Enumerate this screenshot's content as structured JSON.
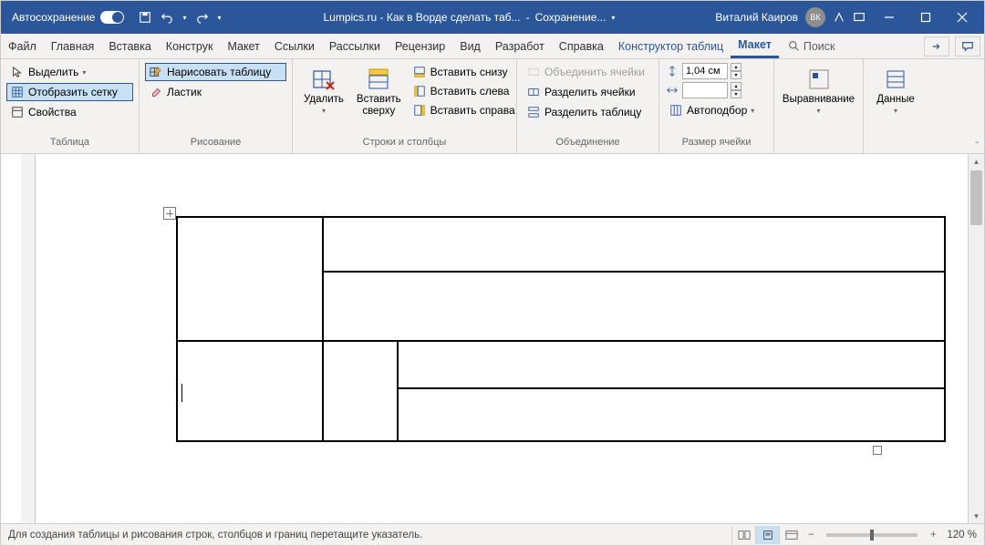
{
  "titlebar": {
    "autosave": "Автосохранение",
    "doc_title": "Lumpics.ru - Как в Ворде сделать таб...",
    "saving": "Сохранение...",
    "user_name": "Виталий Каиров",
    "user_initials": "ВК"
  },
  "tabs": {
    "file": "Файл",
    "home": "Главная",
    "insert": "Вставка",
    "design": "Конструк",
    "layout": "Макет",
    "references": "Ссылки",
    "mailings": "Рассылки",
    "review": "Рецензир",
    "view": "Вид",
    "developer": "Разработ",
    "help": "Справка",
    "table_design": "Конструктор таблиц",
    "table_layout": "Макет",
    "search": "Поиск"
  },
  "ribbon": {
    "table": {
      "select": "Выделить",
      "gridlines": "Отобразить сетку",
      "properties": "Свойства",
      "group": "Таблица"
    },
    "draw": {
      "draw_table": "Нарисовать таблицу",
      "eraser": "Ластик",
      "group": "Рисование"
    },
    "rowscols": {
      "delete": "Удалить",
      "insert_above": "Вставить сверху",
      "insert_below": "Вставить снизу",
      "insert_left": "Вставить слева",
      "insert_right": "Вставить справа",
      "group": "Строки и столбцы"
    },
    "merge": {
      "merge_cells": "Объединить ячейки",
      "split_cells": "Разделить ячейки",
      "split_table": "Разделить таблицу",
      "group": "Объединение"
    },
    "size": {
      "height": "1,04 см",
      "width": "",
      "autofit": "Автоподбор",
      "group": "Размер ячейки"
    },
    "alignment": {
      "label": "Выравнивание"
    },
    "data": {
      "label": "Данные"
    }
  },
  "statusbar": {
    "hint": "Для создания таблицы и рисования строк, столбцов и границ перетащите указатель.",
    "zoom": "120 %"
  }
}
